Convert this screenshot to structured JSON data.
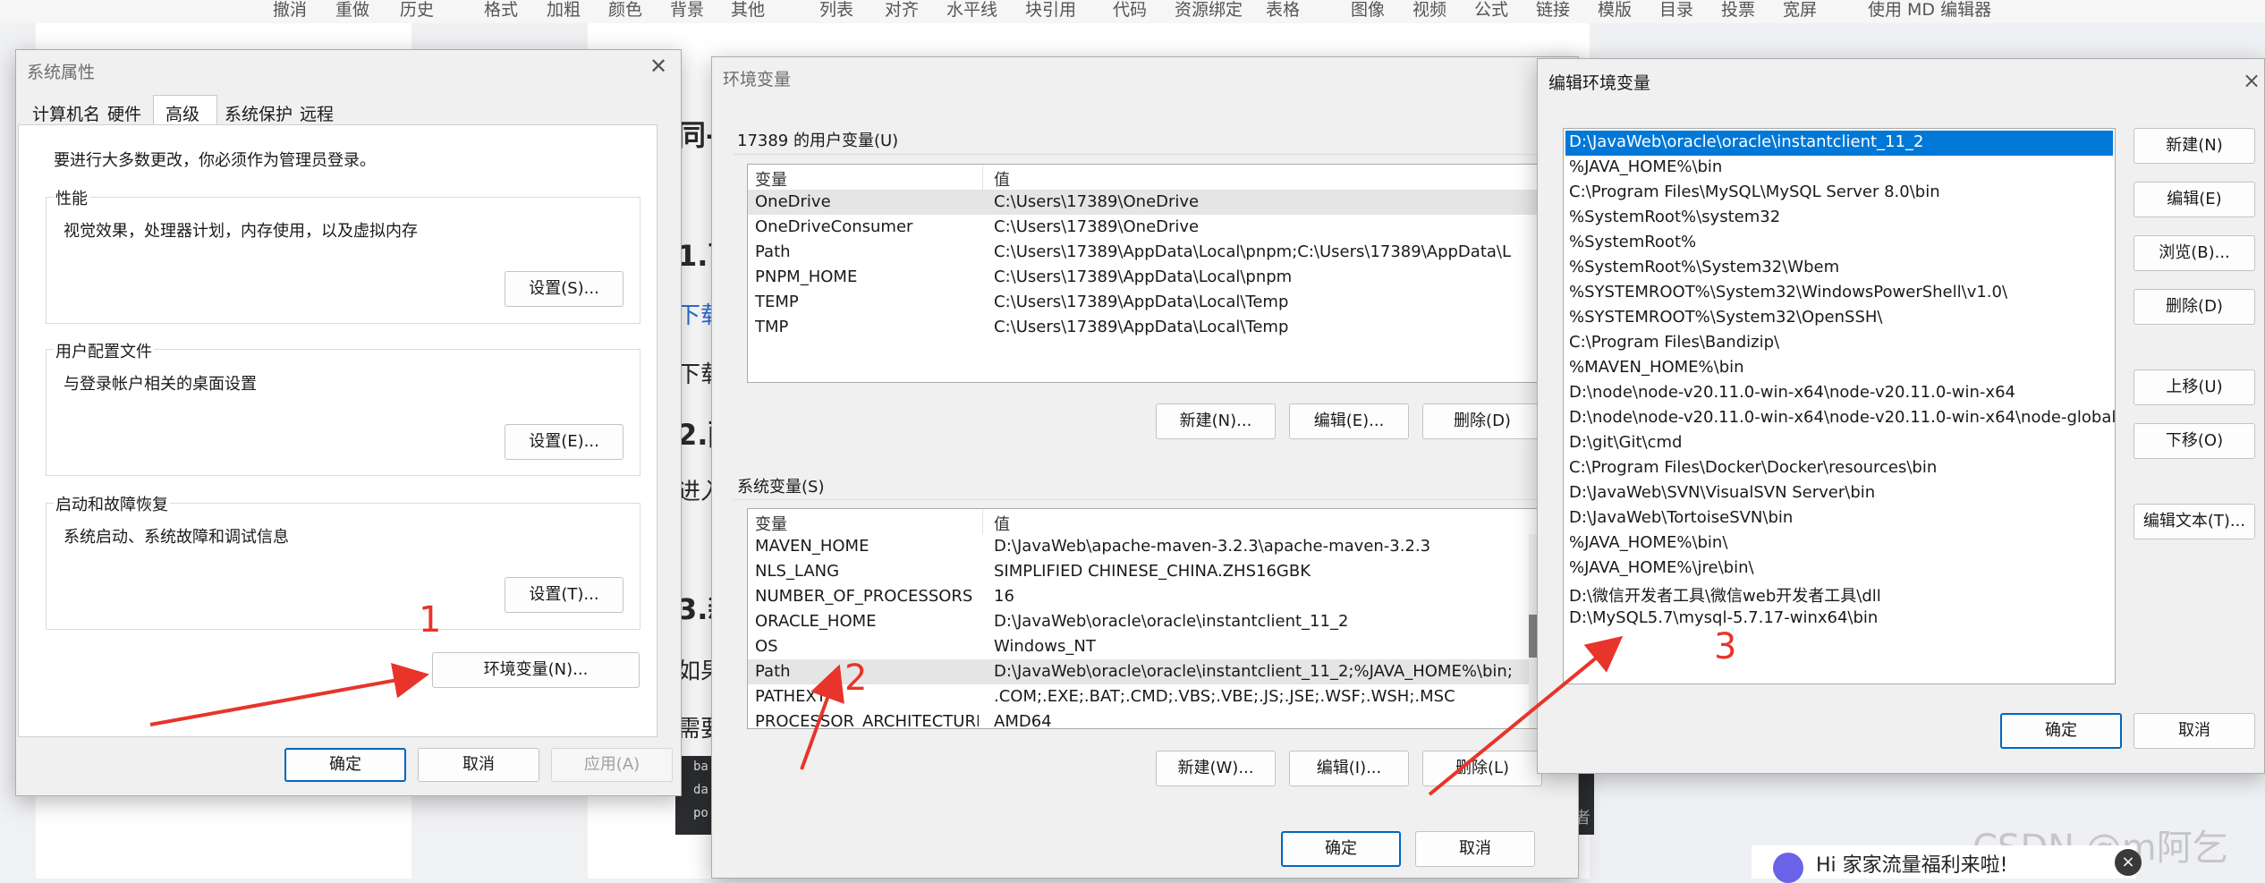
{
  "editor_toolbar": [
    "撤消",
    "重做",
    "历史",
    "格式",
    "加粗",
    "颜色",
    "背景",
    "其他",
    "列表",
    "对齐",
    "水平线",
    "块引用",
    "代码",
    "资源绑定",
    "表格",
    "图像",
    "视频",
    "公式",
    "链接",
    "模版",
    "目录",
    "投票",
    "宽屏",
    "使用 MD 编辑器"
  ],
  "article_fragments": {
    "a": "同-",
    "b": "1.下",
    "c": "下载",
    "d": "下载",
    "e": "2.配",
    "f": "进入",
    "g": "3.新",
    "h": "如果",
    "i": "需要"
  },
  "code_fragments": [
    "ba",
    "da",
    "po"
  ],
  "right_fragment": "者",
  "watermark": "CSDN @m阿乞",
  "promo_text": "Hi 家家流量福利来啦!",
  "promo_close": "×",
  "system_properties": {
    "title": "系统属性",
    "tabs": [
      "计算机名",
      "硬件",
      "高级",
      "系统保护",
      "远程"
    ],
    "active_tab": "高级",
    "admin_note": "要进行大多数更改，你必须作为管理员登录。",
    "performance": {
      "title": "性能",
      "desc": "视觉效果，处理器计划，内存使用，以及虚拟内存",
      "button": "设置(S)..."
    },
    "user_profiles": {
      "title": "用户配置文件",
      "desc": "与登录帐户相关的桌面设置",
      "button": "设置(E)..."
    },
    "startup": {
      "title": "启动和故障恢复",
      "desc": "系统启动、系统故障和调试信息",
      "button": "设置(T)..."
    },
    "env_button": "环境变量(N)...",
    "ok": "确定",
    "cancel": "取消",
    "apply": "应用(A)"
  },
  "env_variables": {
    "title": "环境变量",
    "user_section": "17389 的用户变量(U)",
    "system_section": "系统变量(S)",
    "col_var": "变量",
    "col_val": "值",
    "user_vars": [
      {
        "name": "OneDrive",
        "value": "C:\\Users\\17389\\OneDrive"
      },
      {
        "name": "OneDriveConsumer",
        "value": "C:\\Users\\17389\\OneDrive"
      },
      {
        "name": "Path",
        "value": "C:\\Users\\17389\\AppData\\Local\\pnpm;C:\\Users\\17389\\AppData\\L..."
      },
      {
        "name": "PNPM_HOME",
        "value": "C:\\Users\\17389\\AppData\\Local\\pnpm"
      },
      {
        "name": "TEMP",
        "value": "C:\\Users\\17389\\AppData\\Local\\Temp"
      },
      {
        "name": "TMP",
        "value": "C:\\Users\\17389\\AppData\\Local\\Temp"
      }
    ],
    "system_vars": [
      {
        "name": "MAVEN_HOME",
        "value": "D:\\JavaWeb\\apache-maven-3.2.3\\apache-maven-3.2.3"
      },
      {
        "name": "NLS_LANG",
        "value": "SIMPLIFIED CHINESE_CHINA.ZHS16GBK"
      },
      {
        "name": "NUMBER_OF_PROCESSORS",
        "value": "16"
      },
      {
        "name": "ORACLE_HOME",
        "value": "D:\\JavaWeb\\oracle\\oracle\\instantclient_11_2"
      },
      {
        "name": "OS",
        "value": "Windows_NT"
      },
      {
        "name": "Path",
        "value": "D:\\JavaWeb\\oracle\\oracle\\instantclient_11_2;%JAVA_HOME%\\bin;..."
      },
      {
        "name": "PATHEXT",
        "value": ".COM;.EXE;.BAT;.CMD;.VBS;.VBE;.JS;.JSE;.WSF;.WSH;.MSC"
      },
      {
        "name": "PROCESSOR_ARCHITECTURE",
        "value": "AMD64"
      }
    ],
    "user_buttons": {
      "new": "新建(N)...",
      "edit": "编辑(E)...",
      "delete": "删除(D)"
    },
    "system_buttons": {
      "new": "新建(W)...",
      "edit": "编辑(I)...",
      "delete": "删除(L)"
    },
    "ok": "确定",
    "cancel": "取消"
  },
  "edit_env": {
    "title": "编辑环境变量",
    "entries": [
      "D:\\JavaWeb\\oracle\\oracle\\instantclient_11_2",
      "%JAVA_HOME%\\bin",
      "C:\\Program Files\\MySQL\\MySQL Server 8.0\\bin",
      "%SystemRoot%\\system32",
      "%SystemRoot%",
      "%SystemRoot%\\System32\\Wbem",
      "%SYSTEMROOT%\\System32\\WindowsPowerShell\\v1.0\\",
      "%SYSTEMROOT%\\System32\\OpenSSH\\",
      "C:\\Program Files\\Bandizip\\",
      "%MAVEN_HOME%\\bin",
      "D:\\node\\node-v20.11.0-win-x64\\node-v20.11.0-win-x64",
      "D:\\node\\node-v20.11.0-win-x64\\node-v20.11.0-win-x64\\node-global",
      "D:\\git\\Git\\cmd",
      "C:\\Program Files\\Docker\\Docker\\resources\\bin",
      "D:\\JavaWeb\\SVN\\VisualSVN Server\\bin",
      "D:\\JavaWeb\\TortoiseSVN\\bin",
      "%JAVA_HOME%\\bin\\",
      "%JAVA_HOME%\\jre\\bin\\",
      "D:\\微信开发者工具\\微信web开发者工具\\dll",
      "D:\\MySQL5.7\\mysql-5.7.17-winx64\\bin"
    ],
    "buttons": {
      "new": "新建(N)",
      "edit": "编辑(E)",
      "browse": "浏览(B)...",
      "delete": "删除(D)",
      "up": "上移(U)",
      "down": "下移(O)",
      "edit_text": "编辑文本(T)..."
    },
    "ok": "确定",
    "cancel": "取消",
    "close": "×"
  },
  "annotations": [
    "1",
    "2",
    "3"
  ],
  "colors": {
    "annotation": "#e8342a",
    "selection": "#0078d7",
    "primary_border": "#0067c0"
  }
}
